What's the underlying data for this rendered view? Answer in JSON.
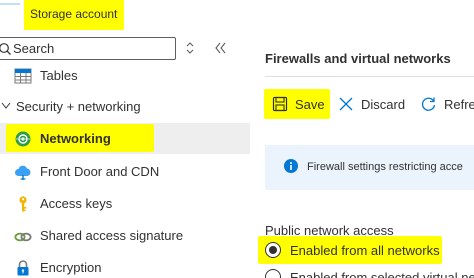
{
  "header": {
    "title": "Storage account"
  },
  "search": {
    "placeholder": "Search"
  },
  "nav": {
    "tables": "Tables",
    "security_group": "Security + networking",
    "networking": "Networking",
    "front_door": "Front Door and CDN",
    "access_keys": "Access keys",
    "sas": "Shared access signature",
    "encryption": "Encryption"
  },
  "pane": {
    "title": "Firewalls and virtual networks",
    "toolbar": {
      "save": "Save",
      "discard": "Discard",
      "refresh": "Refre"
    },
    "info": "Firewall settings restricting acce",
    "public_access": {
      "label": "Public network access",
      "options": [
        "Enabled from all networks",
        "Enabled from selected virtual net"
      ],
      "selected": "Enabled from all networks"
    }
  },
  "colors": {
    "highlight": "#ffff00",
    "accent": "#0078d4",
    "info_bg": "#ebf3fc",
    "selected_bg": "#eeeeee"
  },
  "icons": [
    "search-icon",
    "sort-icon",
    "collapse-icon",
    "tables-icon",
    "chevron-down-icon",
    "networking-icon",
    "front-door-icon",
    "key-icon",
    "link-icon",
    "lock-icon",
    "save-icon",
    "discard-icon",
    "refresh-icon",
    "info-icon"
  ]
}
